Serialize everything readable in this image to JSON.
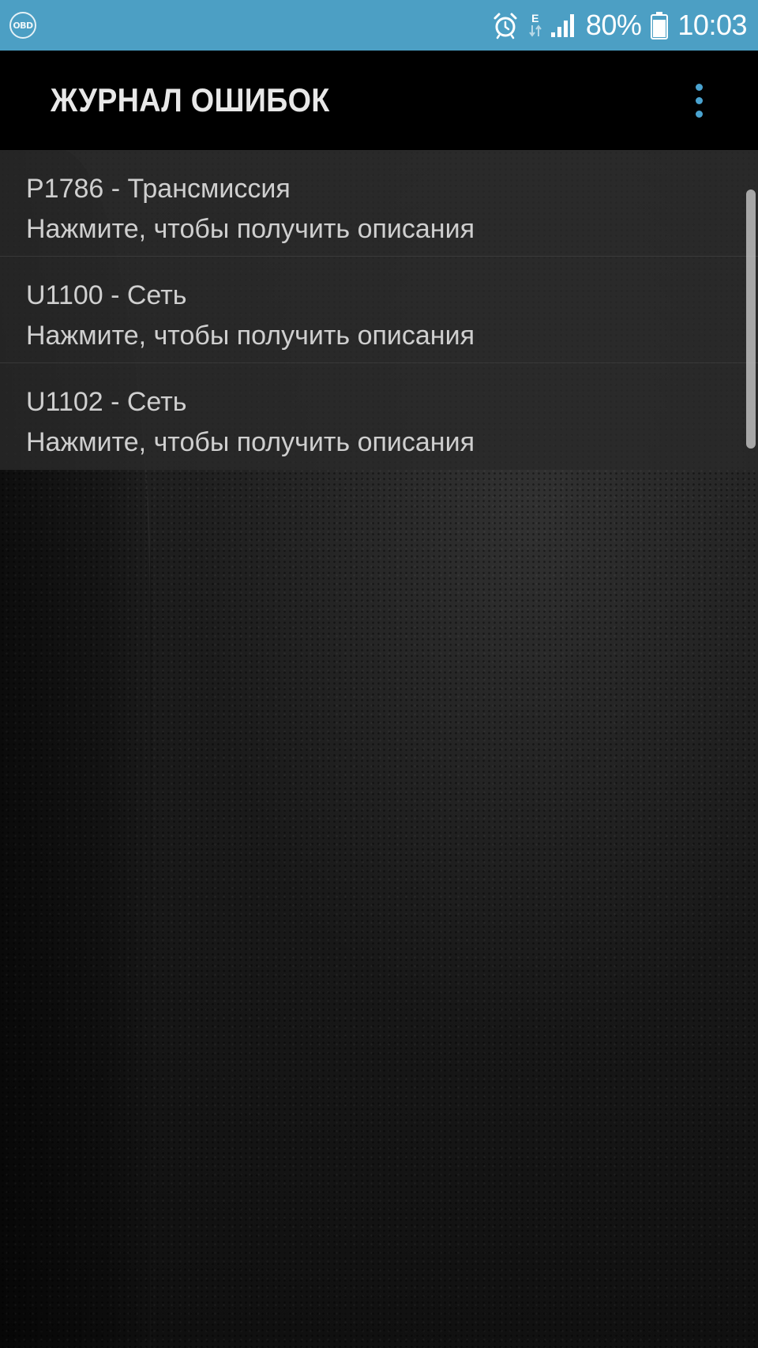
{
  "status_bar": {
    "app_icon_label": "OBD",
    "network_type": "E",
    "battery_percent": "80%",
    "time": "10:03",
    "icons": [
      "obd-icon",
      "alarm-icon",
      "network-arrows-icon",
      "signal-icon",
      "battery-icon"
    ]
  },
  "app_bar": {
    "title": "ЖУРНАЛ ОШИБОК",
    "menu_icon": "overflow-menu-icon",
    "accent_color": "#4aa3d0"
  },
  "dtc_list": [
    {
      "title": "P1786 - Трансмиссия",
      "subtitle": "Нажмите, чтобы получить описания"
    },
    {
      "title": "U1100 - Сеть",
      "subtitle": "Нажмите, чтобы получить описания"
    },
    {
      "title": "U1102 - Сеть",
      "subtitle": "Нажмите, чтобы получить описания"
    }
  ],
  "colors": {
    "status_bar": "#4c9fc4",
    "app_bar": "#000000",
    "text": "#cfcfcf"
  }
}
